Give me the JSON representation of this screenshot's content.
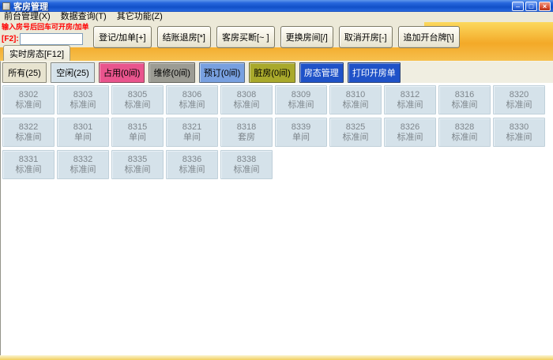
{
  "window": {
    "title": "客房管理",
    "controls": {
      "minimize": "–",
      "restore": "□",
      "close": "×"
    }
  },
  "menu": {
    "items": [
      {
        "label": "前台管理(X)"
      },
      {
        "label": "数据查询(T)"
      },
      {
        "label": "其它功能(Z)"
      }
    ]
  },
  "toolbar": {
    "hint_line1": "输入房号后回车可开房/加单",
    "hint_line2": "[F2]:",
    "room_input_value": "",
    "buttons": [
      {
        "label": "登记/加单[+]"
      },
      {
        "label": "结账退房[*]"
      },
      {
        "label": "客房买断[~ ]"
      },
      {
        "label": "更换房间[/]"
      },
      {
        "label": "取消开房[-]"
      },
      {
        "label": "追加开台牌[\\]"
      }
    ]
  },
  "tabs": [
    {
      "label": "实时房态[F12]",
      "active": true
    }
  ],
  "filters": [
    {
      "label": "所有(25)",
      "bg": "#e7e3cf",
      "fg": "#000000"
    },
    {
      "label": "空闲(25)",
      "bg": "#d5e2ea",
      "fg": "#000000"
    },
    {
      "label": "占用(0间)",
      "bg": "#e9548d",
      "fg": "#000000"
    },
    {
      "label": "维修(0间)",
      "bg": "#9c9c94",
      "fg": "#000000"
    },
    {
      "label": "预订(0间)",
      "bg": "#78a0e0",
      "fg": "#000000"
    },
    {
      "label": "脏房(0间)",
      "bg": "#a9a92b",
      "fg": "#000000"
    },
    {
      "label": "房态管理",
      "bg": "#1f52c8",
      "fg": "#ffffff"
    },
    {
      "label": "打印开房单",
      "bg": "#1f52c8",
      "fg": "#ffffff"
    }
  ],
  "rooms": {
    "vacant_color": "#d5e2ea",
    "rows": [
      [
        {
          "number": "8302",
          "type": "标准间"
        },
        {
          "number": "8303",
          "type": "标准间"
        },
        {
          "number": "8305",
          "type": "标准间"
        },
        {
          "number": "8306",
          "type": "标准间"
        },
        {
          "number": "8308",
          "type": "标准间"
        },
        {
          "number": "8309",
          "type": "标准间"
        },
        {
          "number": "8310",
          "type": "标准间"
        },
        {
          "number": "8312",
          "type": "标准间"
        },
        {
          "number": "8316",
          "type": "标准间"
        },
        {
          "number": "8320",
          "type": "标准间"
        }
      ],
      [
        {
          "number": "8322",
          "type": "标准间"
        },
        {
          "number": "8301",
          "type": "单间"
        },
        {
          "number": "8315",
          "type": "单间"
        },
        {
          "number": "8321",
          "type": "单间"
        },
        {
          "number": "8318",
          "type": "套房"
        },
        {
          "number": "8339",
          "type": "单间"
        },
        {
          "number": "8325",
          "type": "标准间"
        },
        {
          "number": "8326",
          "type": "标准间"
        },
        {
          "number": "8328",
          "type": "标准间"
        },
        {
          "number": "8330",
          "type": "标准间"
        }
      ],
      [
        {
          "number": "8331",
          "type": "标准间"
        },
        {
          "number": "8332",
          "type": "标准间"
        },
        {
          "number": "8335",
          "type": "标准间"
        },
        {
          "number": "8336",
          "type": "标准间"
        },
        {
          "number": "8338",
          "type": "标准间"
        }
      ]
    ]
  }
}
